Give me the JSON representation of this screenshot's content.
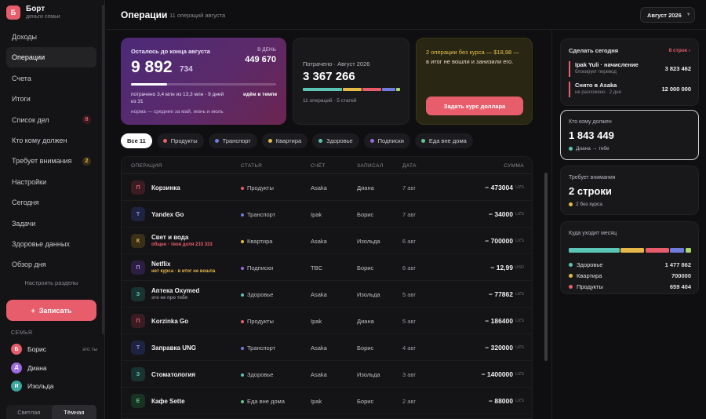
{
  "sidebar": {
    "brand_letter": "Б",
    "brand": "Борт",
    "brand_sub": "деньги семьи",
    "nav": [
      {
        "label": "Доходы",
        "active": false
      },
      {
        "label": "Операции",
        "active": true
      },
      {
        "label": "Счета",
        "active": false
      },
      {
        "label": "Итоги",
        "active": false
      },
      {
        "label": "Список дел",
        "active": false,
        "badge": "8"
      },
      {
        "label": "Кто кому должен",
        "active": false
      },
      {
        "label": "Требует внимания",
        "active": false,
        "badge": "2"
      },
      {
        "label": "Настройки",
        "active": false
      },
      {
        "label": "Сегодня",
        "active": false
      },
      {
        "label": "Задачи",
        "active": false
      },
      {
        "label": "Здоровье данных",
        "active": false
      },
      {
        "label": "Обзор дня",
        "active": false
      }
    ],
    "configure": "Настроить разделы",
    "add_button": "Записать",
    "add_icon": "+",
    "family_title": "СЕМЬЯ",
    "members": [
      {
        "initial": "Б",
        "name": "Борис",
        "note": "это ты",
        "color": "#e85d6c"
      },
      {
        "initial": "Д",
        "name": "Диана",
        "note": "",
        "color": "#9b6ae0"
      },
      {
        "initial": "И",
        "name": "Изольда",
        "note": "",
        "color": "#3aa59a"
      }
    ],
    "theme_light": "Светлая",
    "theme_dark": "Тёмная"
  },
  "header": {
    "title": "Операции",
    "subtitle": "11 операций августа",
    "month": "Август 2026",
    "month_chevron": "▼"
  },
  "remaining": {
    "label": "Осталось до конца августа",
    "value_main": "9 892",
    "value_small": "734",
    "per_day_label": "В ДЕНЬ",
    "per_day_value": "449 670",
    "progress": 0.25,
    "description": "потрачено 3,4 млн из 13,3 млн · 9 дней из 31",
    "tempo": "идём в темпе",
    "norm": "норма — среднее за май, июнь и июль"
  },
  "spent": {
    "label": "Потрачено · Август 2026",
    "value": "3 367 266",
    "segments": [
      {
        "color": "#5cc6b6",
        "share": 0.42
      },
      {
        "color": "#e6b84a",
        "share": 0.2
      },
      {
        "color": "#e85d6c",
        "share": 0.2
      },
      {
        "color": "#6f7ce0",
        "share": 0.14
      },
      {
        "color": "#a8d86a",
        "share": 0.04
      }
    ],
    "footer": "11 операций · 5 статей"
  },
  "rate_warning": {
    "title": "2 операции без курса — $18,98 —",
    "text": "в итог не вошли и занизили его.",
    "button": "Задать курс доллара"
  },
  "filters": [
    {
      "label": "Все 11",
      "color": "",
      "active": true
    },
    {
      "label": "Продукты",
      "color": "#e85d6c",
      "active": false
    },
    {
      "label": "Транспорт",
      "color": "#6f7ce0",
      "active": false
    },
    {
      "label": "Квартира",
      "color": "#e6b84a",
      "active": false
    },
    {
      "label": "Здоровье",
      "color": "#5cc6b6",
      "active": false
    },
    {
      "label": "Подписки",
      "color": "#9b6ae0",
      "active": false
    },
    {
      "label": "Еда вне дома",
      "color": "#5ec88a",
      "active": false
    }
  ],
  "table": {
    "headers": {
      "op": "ОПЕРАЦИЯ",
      "cat": "СТАТЬЯ",
      "acc": "СЧЁТ",
      "who": "ЗАПИСАЛ",
      "date": "ДАТА",
      "sum": "СУММА"
    },
    "rows": [
      {
        "initial": "П",
        "name": "Корзинка",
        "note": "",
        "note_color": "",
        "cat": "Продукты",
        "cat_color": "#e85d6c",
        "acc": "Asaka",
        "who": "Диана",
        "date": "7 авг",
        "amount": "− 473004",
        "cur": "UZS",
        "av_bg": "#3a1c22",
        "av_fg": "#e85d6c"
      },
      {
        "initial": "Т",
        "name": "Yandex Go",
        "note": "",
        "note_color": "",
        "cat": "Транспорт",
        "cat_color": "#6f7ce0",
        "acc": "Ipak",
        "who": "Борис",
        "date": "7 авг",
        "amount": "− 34000",
        "cur": "UZS",
        "av_bg": "#1e2340",
        "av_fg": "#8a96f0"
      },
      {
        "initial": "К",
        "name": "Свет и вода",
        "note": "общее · твоя доля 233 333",
        "note_color": "#e85d6c",
        "cat": "Квартира",
        "cat_color": "#e6b84a",
        "acc": "Asaka",
        "who": "Изольда",
        "date": "6 авг",
        "amount": "− 700000",
        "cur": "UZS",
        "av_bg": "#3a3018",
        "av_fg": "#e6b84a"
      },
      {
        "initial": "П",
        "name": "Netflix",
        "note": "нет курса · в итог не вошла",
        "note_color": "#e6b84a",
        "cat": "Подписки",
        "cat_color": "#9b6ae0",
        "acc": "TBC",
        "who": "Борис",
        "date": "6 авг",
        "amount": "− 12,99",
        "cur": "USD",
        "av_bg": "#2c1e40",
        "av_fg": "#b28af0"
      },
      {
        "initial": "З",
        "name": "Аптека Oxymed",
        "note": "это не про тебя",
        "note_color": "#8a8a92",
        "cat": "Здоровье",
        "cat_color": "#5cc6b6",
        "acc": "Asaka",
        "who": "Изольда",
        "date": "5 авг",
        "amount": "− 77862",
        "cur": "UZS",
        "av_bg": "#183330",
        "av_fg": "#5cc6b6"
      },
      {
        "initial": "П",
        "name": "Korzinka Go",
        "note": "",
        "note_color": "",
        "cat": "Продукты",
        "cat_color": "#e85d6c",
        "acc": "Ipak",
        "who": "Диана",
        "date": "5 авг",
        "amount": "− 186400",
        "cur": "UZS",
        "av_bg": "#3a1c22",
        "av_fg": "#e85d6c"
      },
      {
        "initial": "Т",
        "name": "Заправка UNG",
        "note": "",
        "note_color": "",
        "cat": "Транспорт",
        "cat_color": "#6f7ce0",
        "acc": "Asaka",
        "who": "Борис",
        "date": "4 авг",
        "amount": "− 320000",
        "cur": "UZS",
        "av_bg": "#1e2340",
        "av_fg": "#8a96f0"
      },
      {
        "initial": "З",
        "name": "Стоматология",
        "note": "",
        "note_color": "",
        "cat": "Здоровье",
        "cat_color": "#5cc6b6",
        "acc": "Asaka",
        "who": "Изольда",
        "date": "3 авг",
        "amount": "− 1400000",
        "cur": "UZS",
        "av_bg": "#183330",
        "av_fg": "#5cc6b6"
      },
      {
        "initial": "Е",
        "name": "Кафе Sette",
        "note": "",
        "note_color": "",
        "cat": "Еда вне дома",
        "cat_color": "#5ec88a",
        "acc": "Ipak",
        "who": "Борис",
        "date": "2 авг",
        "amount": "− 88000",
        "cur": "UZS",
        "av_bg": "#183322",
        "av_fg": "#5ec88a"
      }
    ]
  },
  "today": {
    "title": "Сделать сегодня",
    "link": "8 строк ›",
    "items": [
      {
        "name": "Ipak Yuli · начисление",
        "sub": "блокирует перевод",
        "amount": "3 823 462"
      },
      {
        "name": "Снято в Asaka",
        "sub": "не разложено · 2 дня",
        "amount": "12 000 000"
      }
    ]
  },
  "debts": {
    "title": "Кто кому должен",
    "value": "1 843 449",
    "sub": "Диана → тебе",
    "dot_color": "#5cc6b6"
  },
  "attention": {
    "title": "Требует внимания",
    "value": "2 строки",
    "sub": "2 без курса",
    "dot_color": "#e6b84a"
  },
  "month_flow": {
    "title": "Куда уходит месяц",
    "segments": [
      {
        "color": "#5cc6b6",
        "share": 0.43
      },
      {
        "color": "#e6b84a",
        "share": 0.2
      },
      {
        "color": "#e85d6c",
        "share": 0.2
      },
      {
        "color": "#6f7ce0",
        "share": 0.12
      },
      {
        "color": "#a8d86a",
        "share": 0.05
      }
    ],
    "rows": [
      {
        "label": "Здоровье",
        "value": "1 477 862",
        "color": "#5cc6b6"
      },
      {
        "label": "Квартира",
        "value": "700000",
        "color": "#e6b84a"
      },
      {
        "label": "Продукты",
        "value": "659 404",
        "color": "#e85d6c"
      }
    ]
  }
}
